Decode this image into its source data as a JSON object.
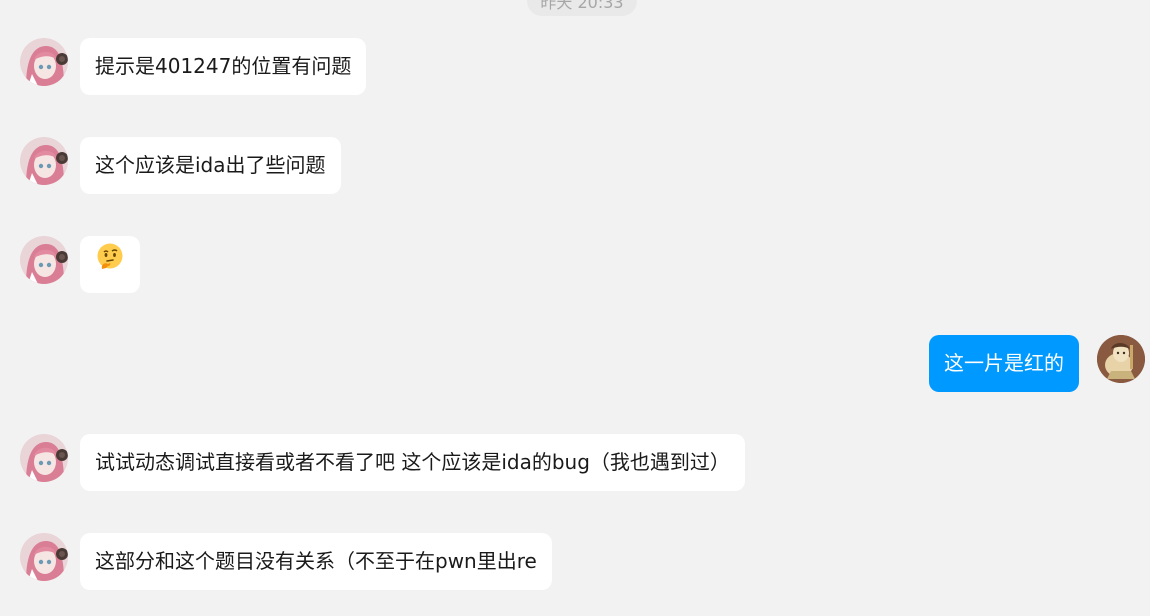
{
  "timestamp": "昨天 20:33",
  "messages": [
    {
      "sender": "other",
      "text": "提示是401247的位置有问题"
    },
    {
      "sender": "other",
      "text": "这个应该是ida出了些问题"
    },
    {
      "sender": "other",
      "emoji": "thinking-face-emoji"
    },
    {
      "sender": "self",
      "text": "这一片是红的"
    },
    {
      "sender": "other",
      "text": "试试动态调试直接看或者不看了吧 这个应该是ida的bug（我也遇到过）"
    },
    {
      "sender": "other",
      "text": "这部分和这个题目没有关系（不至于在pwn里出re"
    }
  ],
  "colors": {
    "background": "#f2f2f2",
    "other_bubble": "#ffffff",
    "self_bubble": "#0099ff",
    "self_text": "#ffffff",
    "text": "#1a1a1a"
  }
}
